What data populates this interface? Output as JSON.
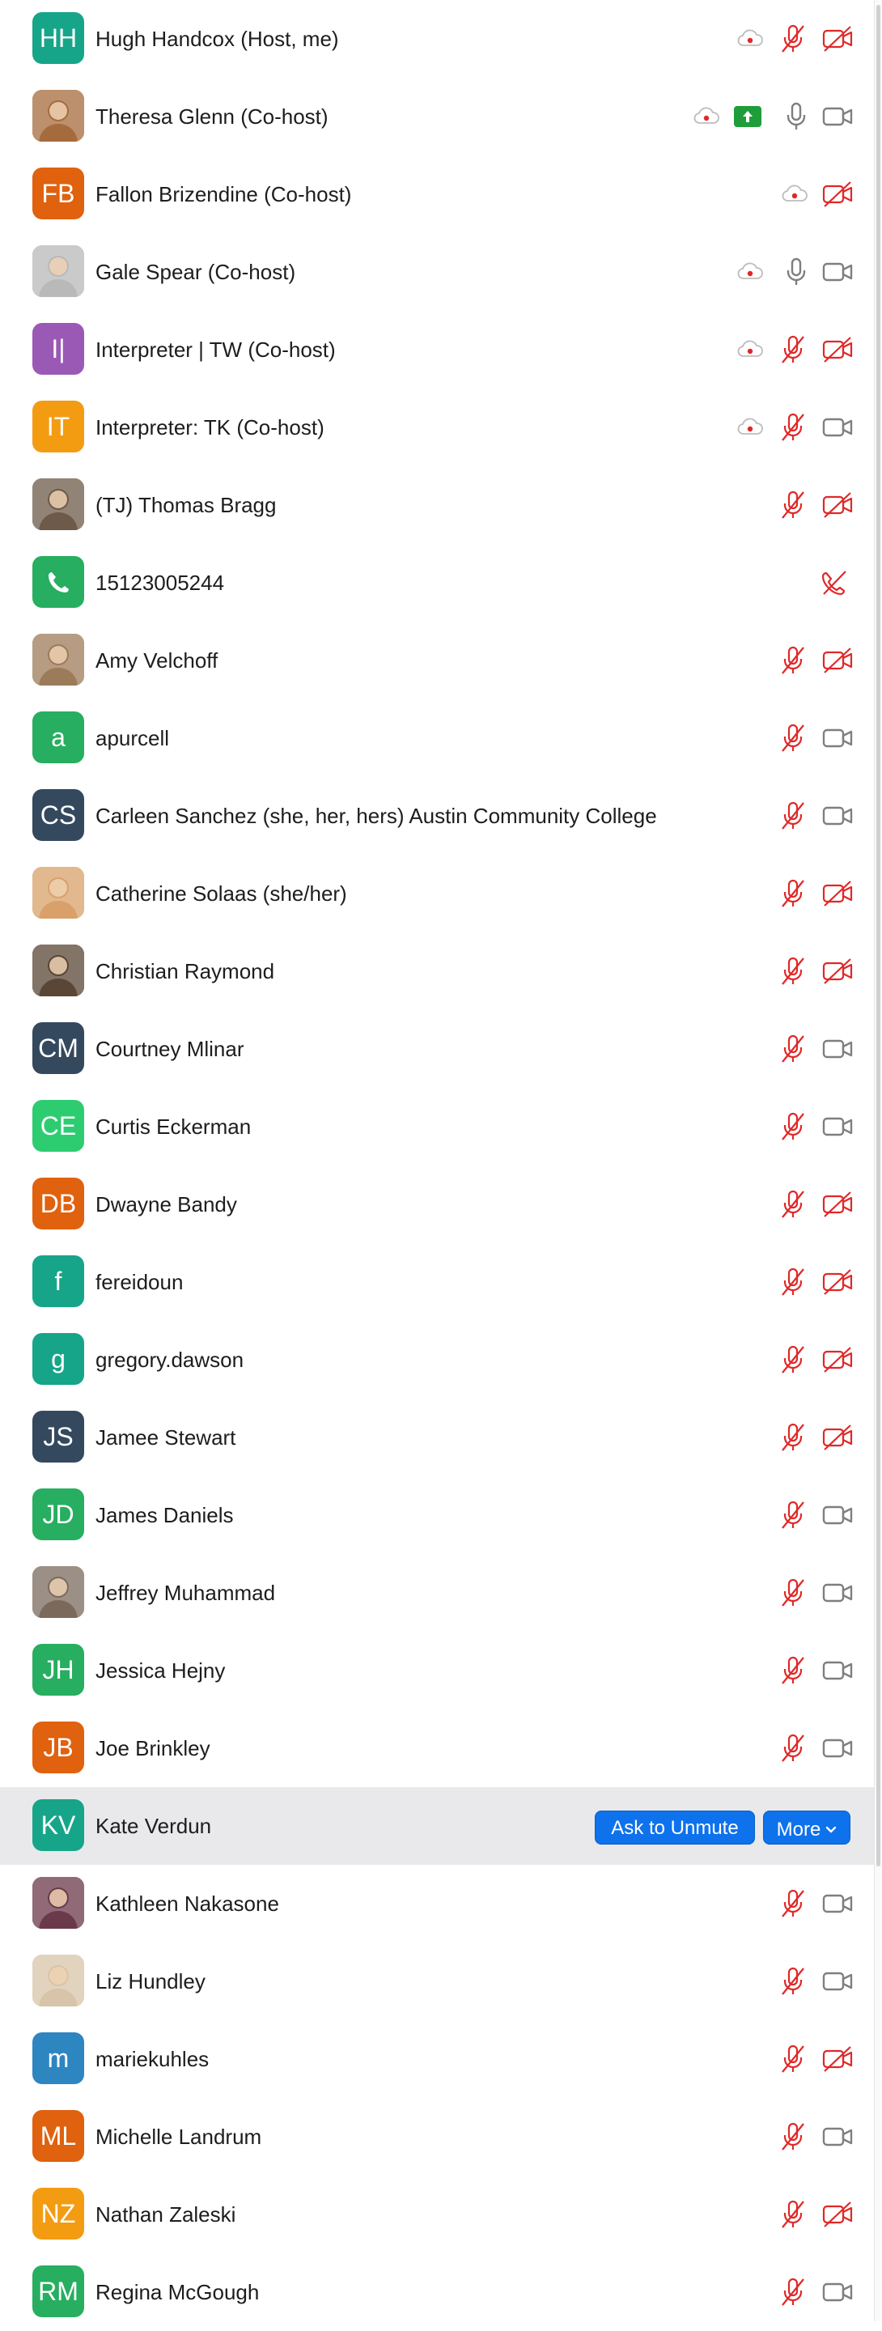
{
  "participants": [
    {
      "name": "Hugh Handcox (Host, me)",
      "initials": "HH",
      "avatar_color": "#17a589",
      "avatar_type": "initials",
      "cloud": true,
      "share": false,
      "mic": "muted",
      "video": "off"
    },
    {
      "name": "Theresa Glenn (Co-host)",
      "initials": "",
      "avatar_color": "#a66b3d",
      "avatar_type": "photo",
      "cloud": true,
      "share": true,
      "mic": "on",
      "video": "on"
    },
    {
      "name": "Fallon Brizendine (Co-host)",
      "initials": "FB",
      "avatar_color": "#e0610e",
      "avatar_type": "initials",
      "cloud": true,
      "share": false,
      "mic": "none",
      "video": "off"
    },
    {
      "name": "Gale Spear (Co-host)",
      "initials": "",
      "avatar_color": "#b9b9b9",
      "avatar_type": "photo",
      "cloud": true,
      "share": false,
      "mic": "on",
      "video": "on"
    },
    {
      "name": "Interpreter | TW (Co-host)",
      "initials": "I|",
      "avatar_color": "#9b59b6",
      "avatar_type": "initials",
      "cloud": true,
      "share": false,
      "mic": "muted",
      "video": "off"
    },
    {
      "name": "Interpreter: TK (Co-host)",
      "initials": "IT",
      "avatar_color": "#f39c12",
      "avatar_type": "initials",
      "cloud": true,
      "share": false,
      "mic": "muted",
      "video": "on"
    },
    {
      "name": "(TJ) Thomas Bragg",
      "initials": "",
      "avatar_color": "#6d5a48",
      "avatar_type": "photo",
      "cloud": false,
      "share": false,
      "mic": "muted",
      "video": "off"
    },
    {
      "name": "15123005244",
      "initials": "",
      "avatar_color": "#27ae60",
      "avatar_type": "phone",
      "cloud": false,
      "share": false,
      "mic": "phone-muted",
      "video": "none"
    },
    {
      "name": "Amy Velchoff",
      "initials": "",
      "avatar_color": "#9c7b5a",
      "avatar_type": "photo",
      "cloud": false,
      "share": false,
      "mic": "muted",
      "video": "off"
    },
    {
      "name": "apurcell",
      "initials": "a",
      "avatar_color": "#27ae60",
      "avatar_type": "initials",
      "cloud": false,
      "share": false,
      "mic": "muted",
      "video": "on"
    },
    {
      "name": "Carleen Sanchez (she, her, hers) Austin Community College",
      "initials": "CS",
      "avatar_color": "#34495e",
      "avatar_type": "initials",
      "cloud": false,
      "share": false,
      "mic": "muted",
      "video": "on"
    },
    {
      "name": "Catherine Solaas (she/her)",
      "initials": "",
      "avatar_color": "#d9a06a",
      "avatar_type": "photo",
      "cloud": false,
      "share": false,
      "mic": "muted",
      "video": "off"
    },
    {
      "name": "Christian Raymond",
      "initials": "",
      "avatar_color": "#5a4636",
      "avatar_type": "photo",
      "cloud": false,
      "share": false,
      "mic": "muted",
      "video": "off"
    },
    {
      "name": "Courtney Mlinar",
      "initials": "CM",
      "avatar_color": "#34495e",
      "avatar_type": "initials",
      "cloud": false,
      "share": false,
      "mic": "muted",
      "video": "on"
    },
    {
      "name": "Curtis Eckerman",
      "initials": "CE",
      "avatar_color": "#2ecc71",
      "avatar_type": "initials",
      "cloud": false,
      "share": false,
      "mic": "muted",
      "video": "on"
    },
    {
      "name": "Dwayne Bandy",
      "initials": "DB",
      "avatar_color": "#e0610e",
      "avatar_type": "initials",
      "cloud": false,
      "share": false,
      "mic": "muted",
      "video": "off"
    },
    {
      "name": "fereidoun",
      "initials": "f",
      "avatar_color": "#17a589",
      "avatar_type": "initials",
      "cloud": false,
      "share": false,
      "mic": "muted",
      "video": "off"
    },
    {
      "name": "gregory.dawson",
      "initials": "g",
      "avatar_color": "#17a589",
      "avatar_type": "initials",
      "cloud": false,
      "share": false,
      "mic": "muted",
      "video": "off"
    },
    {
      "name": "Jamee Stewart",
      "initials": "JS",
      "avatar_color": "#34495e",
      "avatar_type": "initials",
      "cloud": false,
      "share": false,
      "mic": "muted",
      "video": "off"
    },
    {
      "name": "James Daniels",
      "initials": "JD",
      "avatar_color": "#27ae60",
      "avatar_type": "initials",
      "cloud": false,
      "share": false,
      "mic": "muted",
      "video": "on"
    },
    {
      "name": "Jeffrey Muhammad",
      "initials": "",
      "avatar_color": "#7b6a5c",
      "avatar_type": "photo",
      "cloud": false,
      "share": false,
      "mic": "muted",
      "video": "on"
    },
    {
      "name": "Jessica Hejny",
      "initials": "JH",
      "avatar_color": "#27ae60",
      "avatar_type": "initials",
      "cloud": false,
      "share": false,
      "mic": "muted",
      "video": "on"
    },
    {
      "name": "Joe Brinkley",
      "initials": "JB",
      "avatar_color": "#e0610e",
      "avatar_type": "initials",
      "cloud": false,
      "share": false,
      "mic": "muted",
      "video": "on"
    },
    {
      "name": "Kate Verdun",
      "initials": "KV",
      "avatar_color": "#17a589",
      "avatar_type": "initials",
      "cloud": false,
      "share": false,
      "mic": "none",
      "video": "none",
      "selected": true
    },
    {
      "name": "Kathleen Nakasone",
      "initials": "",
      "avatar_color": "#6b3a4a",
      "avatar_type": "photo",
      "cloud": false,
      "share": false,
      "mic": "muted",
      "video": "on"
    },
    {
      "name": "Liz Hundley",
      "initials": "",
      "avatar_color": "#d8c4a8",
      "avatar_type": "photo",
      "cloud": false,
      "share": false,
      "mic": "muted",
      "video": "on"
    },
    {
      "name": "mariekuhles",
      "initials": "m",
      "avatar_color": "#2e86c1",
      "avatar_type": "initials",
      "cloud": false,
      "share": false,
      "mic": "muted",
      "video": "off"
    },
    {
      "name": "Michelle Landrum",
      "initials": "ML",
      "avatar_color": "#e0610e",
      "avatar_type": "initials",
      "cloud": false,
      "share": false,
      "mic": "muted",
      "video": "on"
    },
    {
      "name": "Nathan Zaleski",
      "initials": "NZ",
      "avatar_color": "#f39c12",
      "avatar_type": "initials",
      "cloud": false,
      "share": false,
      "mic": "muted",
      "video": "off"
    },
    {
      "name": "Regina McGough",
      "initials": "RM",
      "avatar_color": "#27ae60",
      "avatar_type": "initials",
      "cloud": false,
      "share": false,
      "mic": "muted",
      "video": "on"
    }
  ],
  "actions": {
    "ask_to_unmute": "Ask to Unmute",
    "more": "More"
  },
  "colors": {
    "muted_red": "#e02828",
    "icon_gray": "#7f7f7f",
    "button_blue": "#0e72ed",
    "selected_row": "#e9e9eb"
  }
}
